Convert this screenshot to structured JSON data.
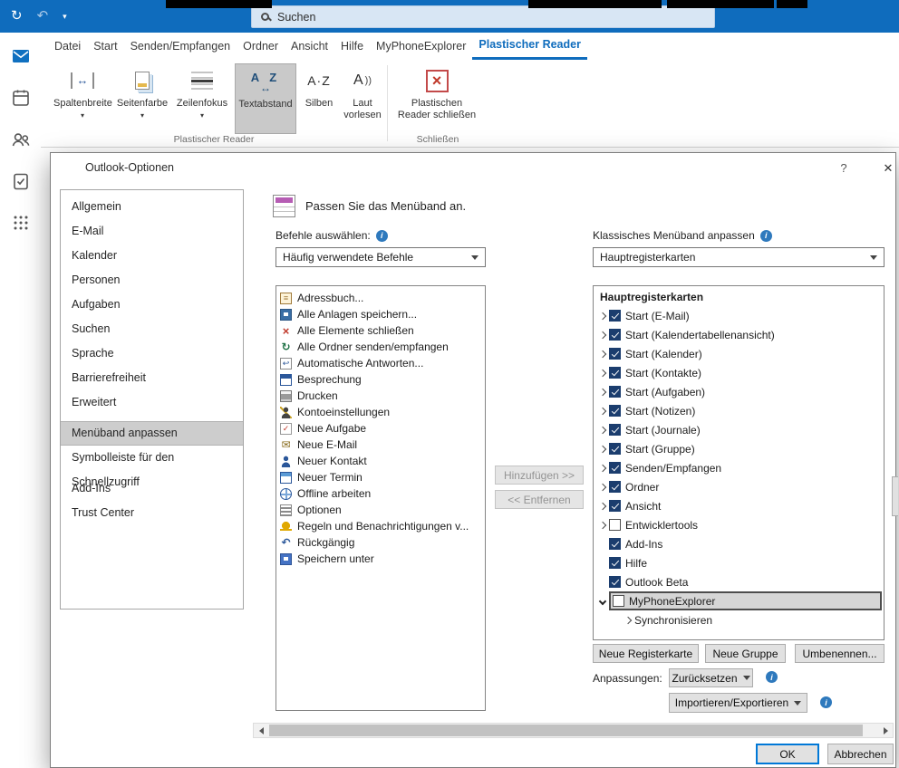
{
  "titlebar": {
    "search_placeholder": "Suchen"
  },
  "ribbon": {
    "tabs": [
      "Datei",
      "Start",
      "Senden/Empfangen",
      "Ordner",
      "Ansicht",
      "Hilfe",
      "MyPhoneExplorer",
      "Plastischer Reader"
    ],
    "active_tab": "Plastischer Reader",
    "buttons": {
      "spaltenbreite": "Spaltenbreite",
      "seitenfarbe": "Seitenfarbe",
      "zeilenfokus": "Zeilenfokus",
      "textabstand": "Textabstand",
      "silben": "Silben",
      "laut_vorlesen": "Laut vorlesen",
      "reader_schliessen": "Plastischen Reader schließen"
    },
    "groups": {
      "reader": "Plastischer Reader",
      "schliessen": "Schließen"
    }
  },
  "dialog": {
    "title": "Outlook-Optionen",
    "help_icon": "?",
    "close_icon": "✕",
    "nav": [
      "Allgemein",
      "E-Mail",
      "Kalender",
      "Personen",
      "Aufgaben",
      "Suchen",
      "Sprache",
      "Barrierefreiheit",
      "Erweitert",
      "Menüband anpassen",
      "Symbolleiste für den Schnellzugriff",
      "Add-Ins",
      "Trust Center"
    ],
    "nav_selected": "Menüband anpassen",
    "header": "Passen Sie das Menüband an.",
    "commands_label": "Befehle auswählen:",
    "commands_value": "Häufig verwendete Befehle",
    "ribbon_label": "Klassisches Menüband anpassen",
    "ribbon_value": "Hauptregisterkarten",
    "commands": [
      {
        "icon": "address-book",
        "label": "Adressbuch..."
      },
      {
        "icon": "save-attachments",
        "label": "Alle Anlagen speichern..."
      },
      {
        "icon": "close-all",
        "label": "Alle Elemente schließen"
      },
      {
        "icon": "send-receive",
        "label": "Alle Ordner senden/empfangen"
      },
      {
        "icon": "auto-reply",
        "label": "Automatische Antworten..."
      },
      {
        "icon": "meeting",
        "label": "Besprechung"
      },
      {
        "icon": "print",
        "label": "Drucken"
      },
      {
        "icon": "account-settings",
        "label": "Kontoeinstellungen"
      },
      {
        "icon": "new-task",
        "label": "Neue Aufgabe"
      },
      {
        "icon": "new-email",
        "label": "Neue E-Mail"
      },
      {
        "icon": "new-contact",
        "label": "Neuer Kontakt"
      },
      {
        "icon": "new-appointment",
        "label": "Neuer Termin"
      },
      {
        "icon": "work-offline",
        "label": "Offline arbeiten"
      },
      {
        "icon": "options",
        "label": "Optionen"
      },
      {
        "icon": "rules-alerts",
        "label": "Regeln und Benachrichtigungen v..."
      },
      {
        "icon": "undo",
        "label": "Rückgängig"
      },
      {
        "icon": "save-as",
        "label": "Speichern unter"
      }
    ],
    "add_button": "Hinzufügen >>",
    "remove_button": "<< Entfernen",
    "tabs_header": "Hauptregisterkarten",
    "tabs": [
      {
        "label": "Start (E-Mail)",
        "checked": true,
        "state": "collapsed"
      },
      {
        "label": "Start (Kalendertabellenansicht)",
        "checked": true,
        "state": "collapsed"
      },
      {
        "label": "Start (Kalender)",
        "checked": true,
        "state": "collapsed"
      },
      {
        "label": "Start (Kontakte)",
        "checked": true,
        "state": "collapsed"
      },
      {
        "label": "Start (Aufgaben)",
        "checked": true,
        "state": "collapsed"
      },
      {
        "label": "Start (Notizen)",
        "checked": true,
        "state": "collapsed"
      },
      {
        "label": "Start (Journale)",
        "checked": true,
        "state": "collapsed"
      },
      {
        "label": "Start (Gruppe)",
        "checked": true,
        "state": "collapsed"
      },
      {
        "label": "Senden/Empfangen",
        "checked": true,
        "state": "collapsed"
      },
      {
        "label": "Ordner",
        "checked": true,
        "state": "collapsed"
      },
      {
        "label": "Ansicht",
        "checked": true,
        "state": "collapsed"
      },
      {
        "label": "Entwicklertools",
        "checked": false,
        "state": "collapsed"
      },
      {
        "label": "Add-Ins",
        "checked": true,
        "state": "none"
      },
      {
        "label": "Hilfe",
        "checked": true,
        "state": "none"
      },
      {
        "label": "Outlook Beta",
        "checked": true,
        "state": "none"
      },
      {
        "label": "MyPhoneExplorer",
        "checked": false,
        "state": "expanded",
        "selected": true
      }
    ],
    "tab_child": {
      "label": "Synchronisieren"
    },
    "new_tab_button": "Neue Registerkarte",
    "new_group_button": "Neue Gruppe",
    "rename_button": "Umbenennen...",
    "customizations_label": "Anpassungen:",
    "reset_button": "Zurücksetzen",
    "import_export_button": "Importieren/Exportieren",
    "ok_button": "OK",
    "cancel_button": "Abbrechen"
  }
}
